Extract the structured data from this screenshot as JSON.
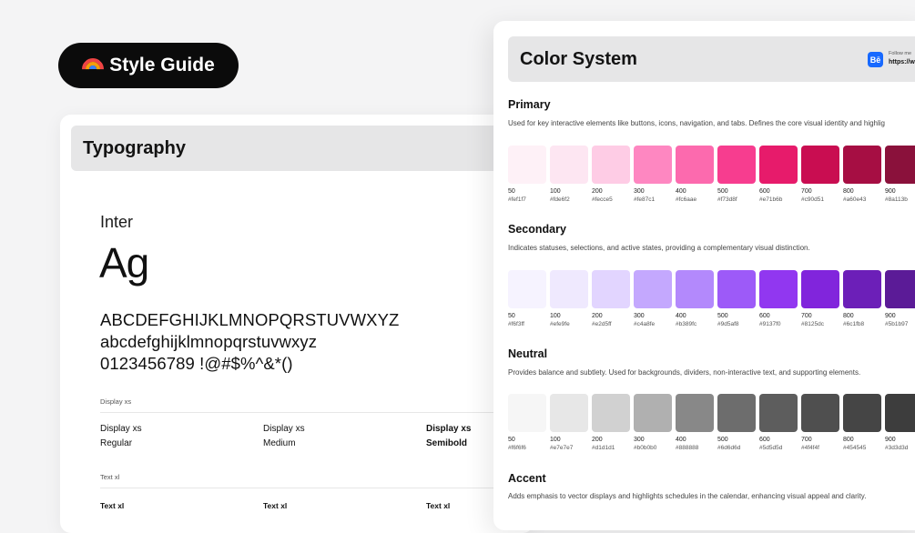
{
  "badge": {
    "label": "Style Guide",
    "icon": "rainbow-icon"
  },
  "typography": {
    "title": "Typography",
    "font_name": "Inter",
    "specimen": "Ag",
    "uppercase": "ABCDEFGHIJKLMNOPQRSTUVWXYZ",
    "lowercase": "abcdefghijklmnopqrstuvwxyz",
    "numerals": "0123456789 !@#$%^&*()",
    "display_xs": {
      "label": "Display xs",
      "samples": [
        {
          "name": "Display xs",
          "weight": "Regular"
        },
        {
          "name": "Display xs",
          "weight": "Medium"
        },
        {
          "name": "Display xs",
          "weight": "Semibold"
        }
      ]
    },
    "text_xl": {
      "label": "Text xl",
      "samples": [
        "Text xl",
        "Text xl",
        "Text xl"
      ]
    }
  },
  "colors": {
    "title": "Color System",
    "follow_label": "Follow me",
    "follow_url": "https://w",
    "groups": [
      {
        "name": "Primary",
        "description": "Used for key interactive elements like buttons, icons, navigation, and tabs. Defines the core visual identity and highlig",
        "swatches": [
          {
            "shade": "50",
            "hex": "#fef1f7"
          },
          {
            "shade": "100",
            "hex": "#fde6f2"
          },
          {
            "shade": "200",
            "hex": "#fecce5"
          },
          {
            "shade": "300",
            "hex": "#fe87c1"
          },
          {
            "shade": "400",
            "hex": "#fc6aae"
          },
          {
            "shade": "500",
            "hex": "#f73d8f"
          },
          {
            "shade": "600",
            "hex": "#e71b6b"
          },
          {
            "shade": "700",
            "hex": "#c90d51"
          },
          {
            "shade": "800",
            "hex": "#a60e43"
          },
          {
            "shade": "900",
            "hex": "#8a113b"
          }
        ]
      },
      {
        "name": "Secondary",
        "description": "Indicates statuses, selections, and active states, providing a complementary visual distinction.",
        "swatches": [
          {
            "shade": "50",
            "hex": "#f6f3ff"
          },
          {
            "shade": "100",
            "hex": "#efe9fe"
          },
          {
            "shade": "200",
            "hex": "#e2d5ff"
          },
          {
            "shade": "300",
            "hex": "#c4a8fe"
          },
          {
            "shade": "400",
            "hex": "#b389fc"
          },
          {
            "shade": "500",
            "hex": "#9d5af8"
          },
          {
            "shade": "600",
            "hex": "#9137f0"
          },
          {
            "shade": "700",
            "hex": "#8125dc"
          },
          {
            "shade": "800",
            "hex": "#6c1fb8"
          },
          {
            "shade": "900",
            "hex": "#5b1b97"
          }
        ]
      },
      {
        "name": "Neutral",
        "description": "Provides balance and subtlety. Used for backgrounds, dividers, non-interactive text, and supporting elements.",
        "swatches": [
          {
            "shade": "50",
            "hex": "#f6f6f6"
          },
          {
            "shade": "100",
            "hex": "#e7e7e7"
          },
          {
            "shade": "200",
            "hex": "#d1d1d1"
          },
          {
            "shade": "300",
            "hex": "#b0b0b0"
          },
          {
            "shade": "400",
            "hex": "#888888"
          },
          {
            "shade": "500",
            "hex": "#6d6d6d"
          },
          {
            "shade": "600",
            "hex": "#5d5d5d"
          },
          {
            "shade": "700",
            "hex": "#4f4f4f"
          },
          {
            "shade": "800",
            "hex": "#454545"
          },
          {
            "shade": "900",
            "hex": "#3d3d3d"
          }
        ]
      },
      {
        "name": "Accent",
        "description": "Adds emphasis to vector displays and highlights schedules in the calendar, enhancing visual appeal and clarity.",
        "swatches": []
      }
    ]
  }
}
